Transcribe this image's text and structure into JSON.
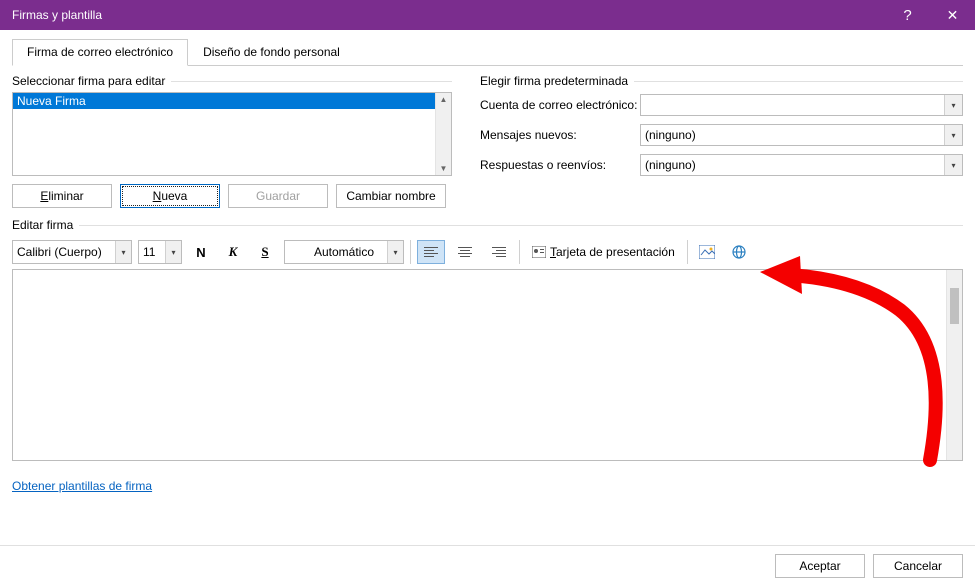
{
  "window": {
    "title": "Firmas y plantilla",
    "help_label": "?",
    "close_label": "✕"
  },
  "tabs": {
    "active": "Firma de correo electrónico",
    "inactive": "Diseño de fondo personal"
  },
  "left": {
    "group_label": "Seleccionar firma para editar",
    "items": [
      "Nueva Firma"
    ],
    "buttons": {
      "delete": "Eliminar",
      "new": "Nueva",
      "save": "Guardar",
      "rename": "Cambiar nombre"
    }
  },
  "right": {
    "group_label": "Elegir firma predeterminada",
    "account_label": "Cuenta de correo electrónico:",
    "account_value": "",
    "new_msgs_label": "Mensajes nuevos:",
    "new_msgs_value": "(ninguno)",
    "replies_label": "Respuestas o reenvíos:",
    "replies_value": "(ninguno)"
  },
  "editor": {
    "group_label": "Editar firma",
    "font": "Calibri (Cuerpo)",
    "size": "11",
    "bold": "N",
    "italic": "K",
    "underline": "S",
    "color": "Automático",
    "business_card": "Tarjeta de presentación"
  },
  "link": {
    "templates": "Obtener plantillas de firma"
  },
  "footer": {
    "ok": "Aceptar",
    "cancel": "Cancelar"
  }
}
